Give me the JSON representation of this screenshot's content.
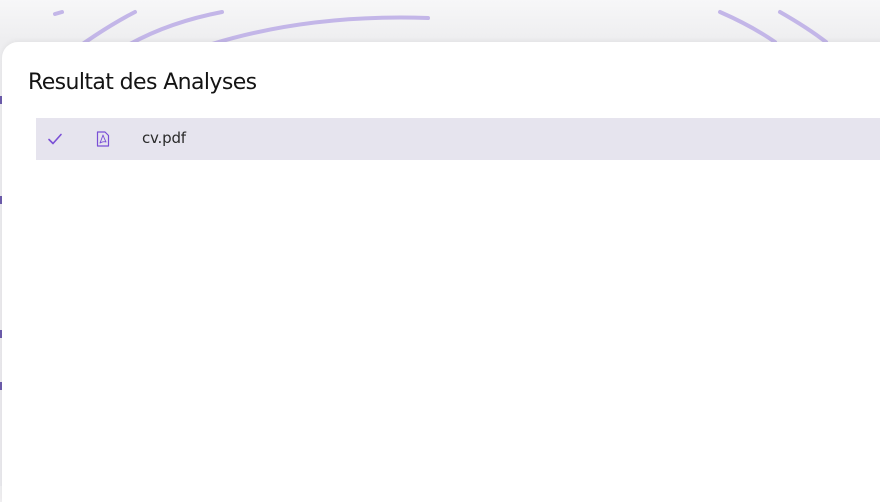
{
  "results": {
    "title": "Resultat des Analyses",
    "files": [
      {
        "name": "cv.pdf",
        "status_icon": "check-icon",
        "type_icon": "pdf-file-icon"
      }
    ]
  },
  "colors": {
    "accent": "#7a4fd6",
    "row_background": "#e6e4ee",
    "decor_arcs": "#c3b6e8"
  }
}
